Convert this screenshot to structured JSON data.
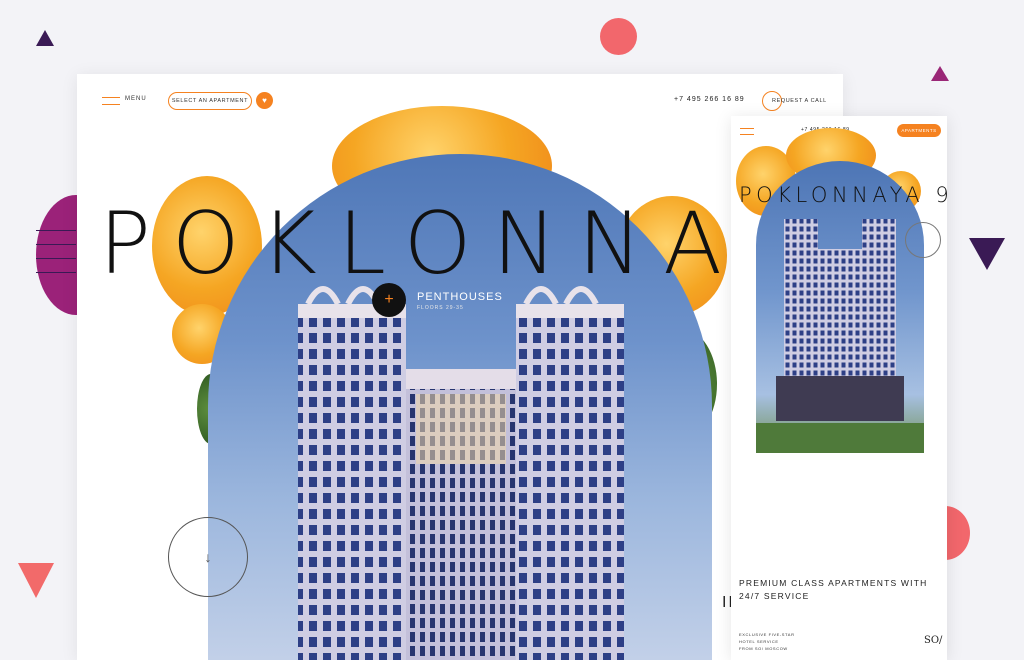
{
  "colors": {
    "accent": "#f58220",
    "purple": "#3a1a55",
    "coral": "#f2676c",
    "magenta": "#9b2279"
  },
  "desktop": {
    "nav": {
      "menu_label": "MENU",
      "select_button": "SELECT AN APARTMENT",
      "favorite_icon": "heart-icon",
      "phone": "+7 495 266 16 89",
      "call_button": "REQUEST A CALL"
    },
    "hero": {
      "title": "POKLONNAYA",
      "penthouses_title": "PENTHOUSES",
      "penthouses_floors": "FLOORS 29-35",
      "plus_icon": "+",
      "scroll_icon": "↓",
      "text_fragment": "IN"
    }
  },
  "mobile": {
    "phone": "+7 495 266 16 89",
    "apartments_button": "APARTMENTS",
    "title": "POKLONNAYA 9",
    "tagline": "PREMIUM CLASS APARTMENTS WITH 24/7 SERVICE",
    "details": [
      "EXCLUSIVE FIVE-STAR",
      "HOTEL SERVICE",
      "FROM SO/ MOSCOW"
    ],
    "logo": "SO/"
  }
}
